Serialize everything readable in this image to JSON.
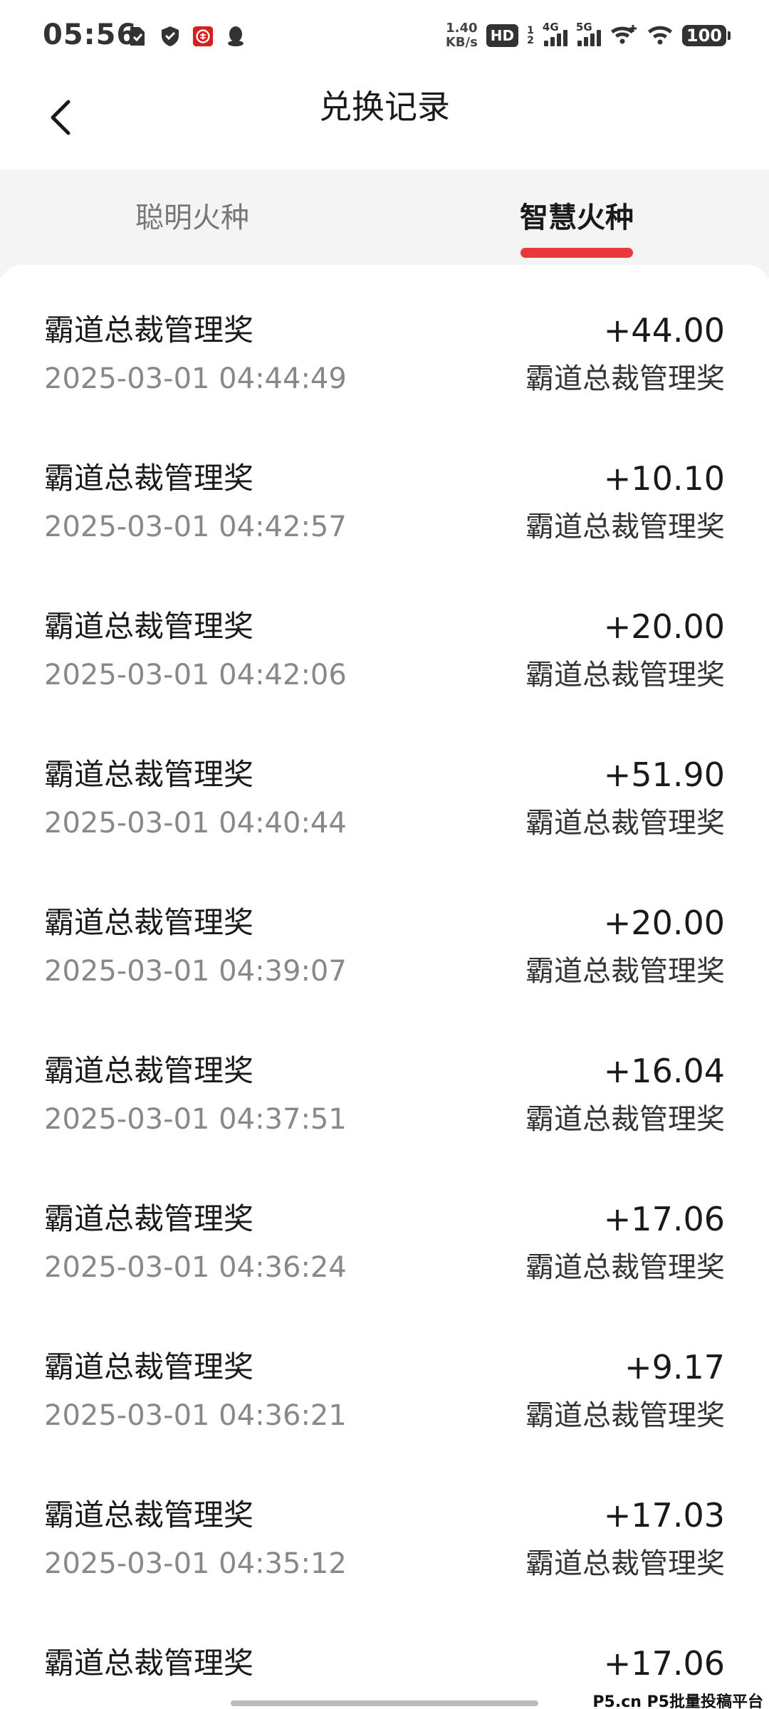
{
  "status_bar": {
    "time": "05:56",
    "net_speed_value": "1.40",
    "net_speed_unit": "KB/s",
    "hd_label": "HD",
    "hd_sub_top": "1",
    "hd_sub_bottom": "2",
    "signal_1_label": "4G",
    "signal_2_label": "5G",
    "battery": "100"
  },
  "header": {
    "title": "兑换记录"
  },
  "tabs": [
    {
      "label": "聪明火种",
      "active": false
    },
    {
      "label": "智慧火种",
      "active": true
    }
  ],
  "colors": {
    "accent": "#e8383d",
    "tabs_background": "#f4f4f4",
    "time_text": "#888888"
  },
  "records": [
    {
      "title": "霸道总裁管理奖",
      "time": "2025-03-01 04:44:49",
      "amount": "+44.00",
      "type": "霸道总裁管理奖"
    },
    {
      "title": "霸道总裁管理奖",
      "time": "2025-03-01 04:42:57",
      "amount": "+10.10",
      "type": "霸道总裁管理奖"
    },
    {
      "title": "霸道总裁管理奖",
      "time": "2025-03-01 04:42:06",
      "amount": "+20.00",
      "type": "霸道总裁管理奖"
    },
    {
      "title": "霸道总裁管理奖",
      "time": "2025-03-01 04:40:44",
      "amount": "+51.90",
      "type": "霸道总裁管理奖"
    },
    {
      "title": "霸道总裁管理奖",
      "time": "2025-03-01 04:39:07",
      "amount": "+20.00",
      "type": "霸道总裁管理奖"
    },
    {
      "title": "霸道总裁管理奖",
      "time": "2025-03-01 04:37:51",
      "amount": "+16.04",
      "type": "霸道总裁管理奖"
    },
    {
      "title": "霸道总裁管理奖",
      "time": "2025-03-01 04:36:24",
      "amount": "+17.06",
      "type": "霸道总裁管理奖"
    },
    {
      "title": "霸道总裁管理奖",
      "time": "2025-03-01 04:36:21",
      "amount": "+9.17",
      "type": "霸道总裁管理奖"
    },
    {
      "title": "霸道总裁管理奖",
      "time": "2025-03-01 04:35:12",
      "amount": "+17.03",
      "type": "霸道总裁管理奖"
    },
    {
      "title": "霸道总裁管理奖",
      "time": "",
      "amount": "+17.06",
      "type": ""
    }
  ],
  "watermark": "P5.cn P5批量投稿平台",
  "icons": [
    "sim-icon",
    "shield-icon",
    "bank-app-icon",
    "qq-icon",
    "signal-icon",
    "wifi-plus-icon",
    "wifi-icon",
    "back-arrow-icon"
  ]
}
